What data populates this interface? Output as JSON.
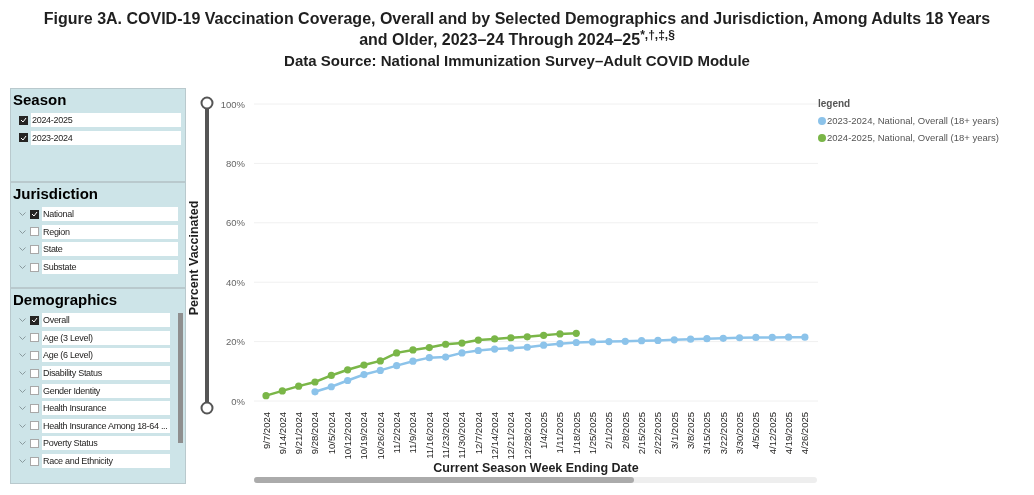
{
  "title": "Figure 3A. COVID-19 Vaccination Coverage, Overall and by Selected Demographics and Jurisdiction, Among Adults 18 Years and Older, 2023–24 Through 2024–25$^{*,†,‡,§}$",
  "subtitle": "Data Source: National Immunization Survey–Adult COVID Module",
  "filters": [
    {
      "heading": "Season",
      "kind": "flat",
      "scrollable": false,
      "items": [
        {
          "label": "2024-2025",
          "checked": true
        },
        {
          "label": "2023-2024",
          "checked": true
        }
      ]
    },
    {
      "heading": "Jurisdiction",
      "kind": "tree",
      "scrollable": false,
      "items": [
        {
          "label": "National",
          "checked": true
        },
        {
          "label": "Region",
          "checked": false
        },
        {
          "label": "State",
          "checked": false
        },
        {
          "label": "Substate",
          "checked": false
        }
      ]
    },
    {
      "heading": "Demographics",
      "kind": "tree",
      "scrollable": true,
      "items": [
        {
          "label": "Overall",
          "checked": true
        },
        {
          "label": "Age (3 Level)",
          "checked": false
        },
        {
          "label": "Age (6 Level)",
          "checked": false
        },
        {
          "label": "Disability Status",
          "checked": false
        },
        {
          "label": "Gender Identity",
          "checked": false
        },
        {
          "label": "Health Insurance",
          "checked": false
        },
        {
          "label": "Health Insurance Among 18-64 ...",
          "checked": false
        },
        {
          "label": "Poverty Status",
          "checked": false
        },
        {
          "label": "Race and Ethnicity",
          "checked": false
        }
      ]
    }
  ],
  "chart": {
    "chart_data": {
      "type": "line",
      "grid": true,
      "legend": {
        "title": "legend"
      },
      "xlabel": "Current Season Week Ending Date",
      "ylabel": "Percent Vaccinated",
      "categories": [
        "9/7/2024",
        "9/14/2024",
        "9/21/2024",
        "9/28/2024",
        "10/5/2024",
        "10/12/2024",
        "10/19/2024",
        "10/26/2024",
        "11/2/2024",
        "11/9/2024",
        "11/16/2024",
        "11/23/2024",
        "11/30/2024",
        "12/7/2024",
        "12/14/2024",
        "12/21/2024",
        "12/28/2024",
        "1/4/2025",
        "1/11/2025",
        "1/18/2025",
        "1/25/2025",
        "2/1/2025",
        "2/8/2025",
        "2/15/2025",
        "2/22/2025",
        "3/1/2025",
        "3/8/2025",
        "3/15/2025",
        "3/22/2025",
        "3/30/2025",
        "4/5/2025",
        "4/12/2025",
        "4/19/2025",
        "4/26/2025"
      ],
      "series": [
        {
          "name": "2023-2024, National, Overall (18+ years)",
          "color": "#8cc3ea",
          "marker": "circle",
          "values": [
            null,
            null,
            null,
            3.1,
            4.8,
            6.9,
            8.9,
            10.3,
            11.9,
            13.4,
            14.6,
            14.8,
            16.2,
            17.0,
            17.5,
            17.8,
            18.1,
            18.8,
            19.3,
            19.7,
            19.9,
            20.0,
            20.1,
            20.3,
            20.4,
            20.6,
            20.8,
            21.0,
            21.1,
            21.3,
            21.4,
            21.4,
            21.5,
            21.5
          ]
        },
        {
          "name": "2024-2025, National, Overall (18+ years)",
          "color": "#7ab648",
          "marker": "circle",
          "values": [
            1.8,
            3.4,
            5.0,
            6.4,
            8.6,
            10.5,
            12.1,
            13.5,
            16.2,
            17.2,
            18.0,
            19.1,
            19.5,
            20.5,
            20.9,
            21.3,
            21.6,
            22.1,
            22.6,
            22.8,
            null,
            null,
            null,
            null,
            null,
            null,
            null,
            null,
            null,
            null,
            null,
            null,
            null,
            null
          ]
        }
      ],
      "ylim": [
        0,
        100
      ],
      "yticks": [
        {
          "value": 0,
          "label": "0%"
        },
        {
          "value": 20,
          "label": "20%"
        },
        {
          "value": 40,
          "label": "40%"
        },
        {
          "value": 60,
          "label": "60%"
        },
        {
          "value": 80,
          "label": "80%"
        },
        {
          "value": 100,
          "label": "100%"
        }
      ]
    }
  }
}
